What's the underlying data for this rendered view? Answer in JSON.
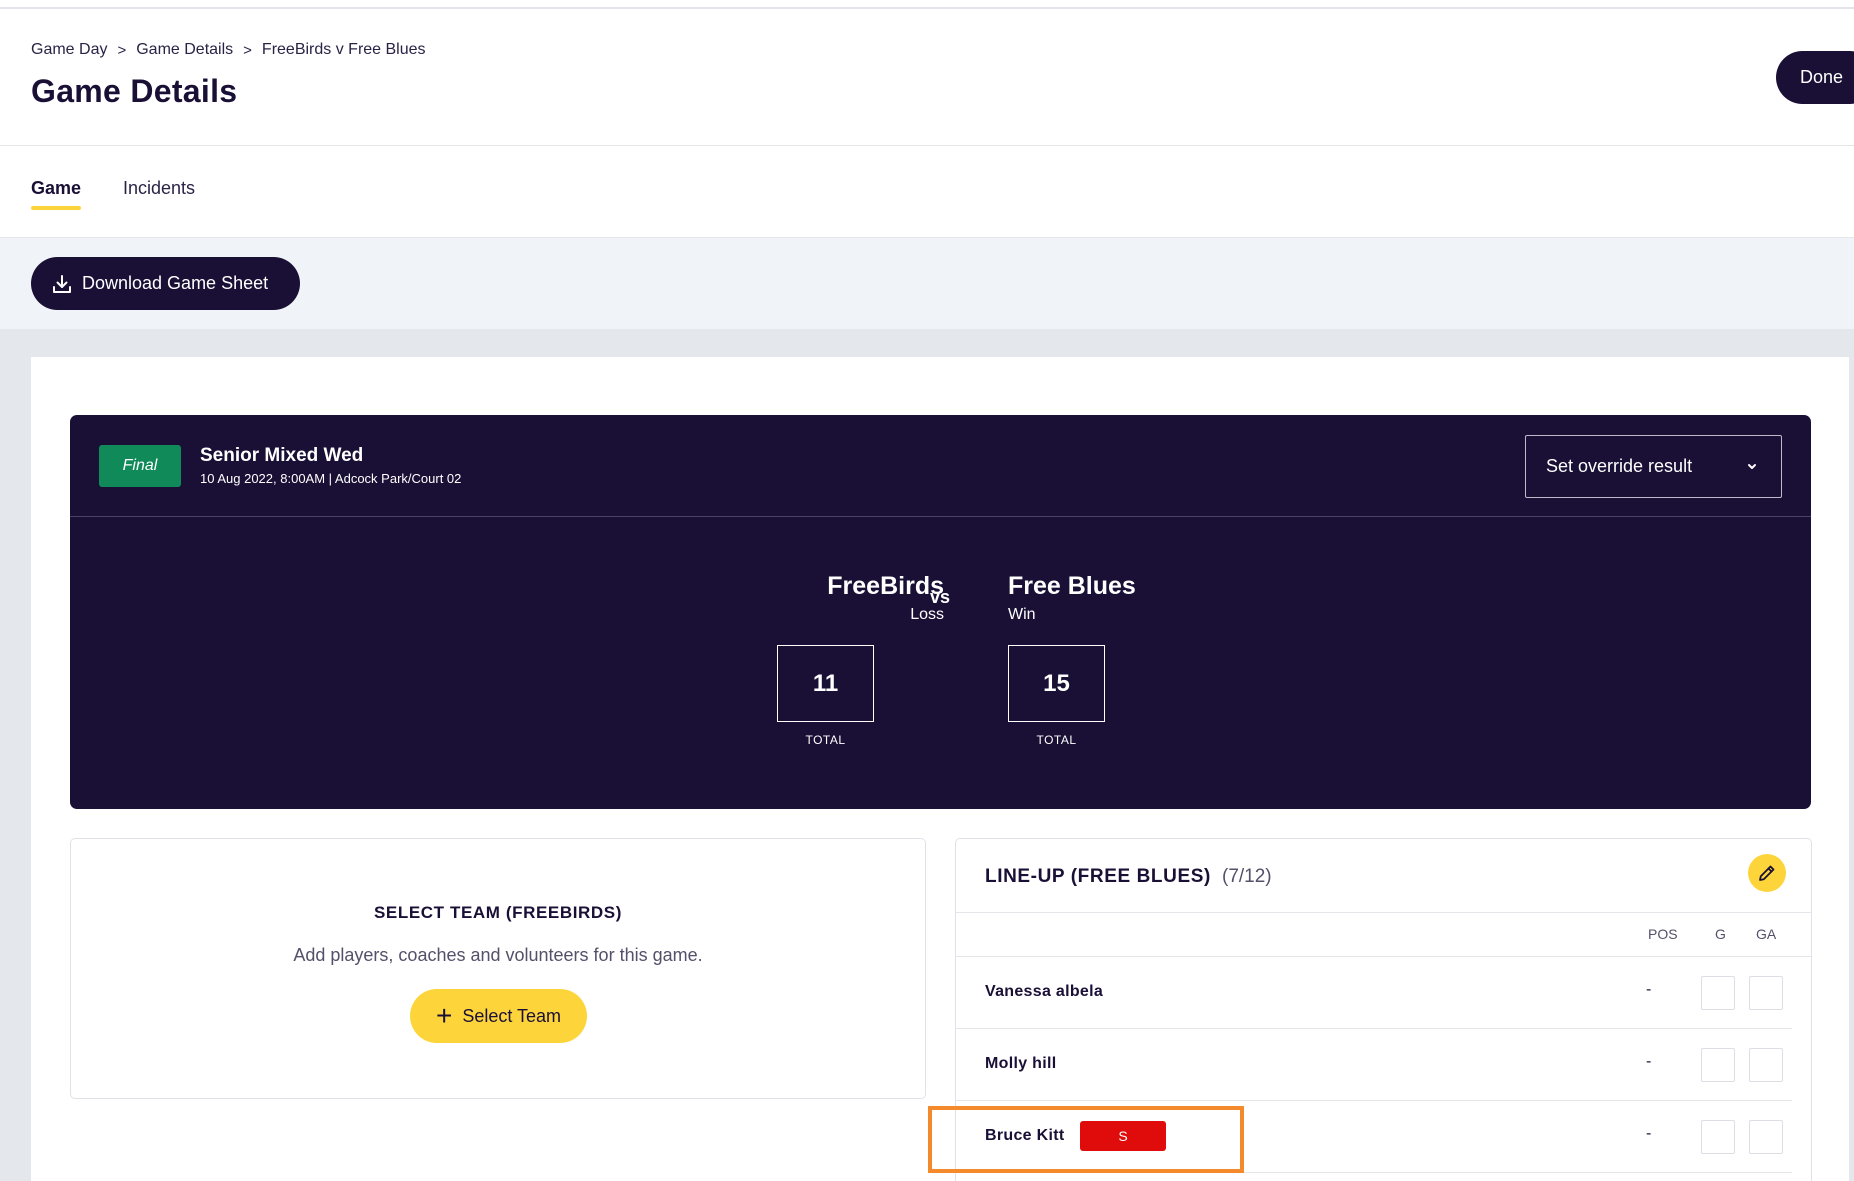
{
  "breadcrumb": [
    "Game Day",
    "Game Details",
    "FreeBirds v Free Blues"
  ],
  "page_title": "Game Details",
  "done_label": "Done",
  "tabs": [
    {
      "label": "Game",
      "active": true
    },
    {
      "label": "Incidents",
      "active": false
    }
  ],
  "download_label": "Download Game Sheet",
  "game": {
    "status": "Final",
    "competition": "Senior Mixed Wed",
    "meta": "10 Aug 2022, 8:00AM | Adcock Park/Court 02",
    "override_label": "Set override result",
    "vs": "vs",
    "home": {
      "name": "FreeBirds",
      "result": "Loss",
      "score": "11",
      "total_label": "TOTAL"
    },
    "away": {
      "name": "Free Blues",
      "result": "Win",
      "score": "15",
      "total_label": "TOTAL"
    }
  },
  "select_team": {
    "title": "SELECT TEAM (FREEBIRDS)",
    "subtitle": "Add players, coaches and volunteers for this game.",
    "button_label": "Select Team"
  },
  "lineup": {
    "title": "LINE-UP (FREE BLUES)",
    "count": "(7/12)",
    "columns": [
      "POS",
      "G",
      "GA"
    ],
    "players": [
      {
        "name": "Vanessa albela",
        "pos": "-",
        "badge": ""
      },
      {
        "name": "Molly hill",
        "pos": "-",
        "badge": ""
      },
      {
        "name": "Bruce Kitt",
        "pos": "-",
        "badge": "S"
      }
    ]
  },
  "colors": {
    "navy": "#1a0f35",
    "accent": "#fdd53b",
    "final": "#0f8a58",
    "suspended": "#e00c0c",
    "highlight": "#f58a2c"
  }
}
